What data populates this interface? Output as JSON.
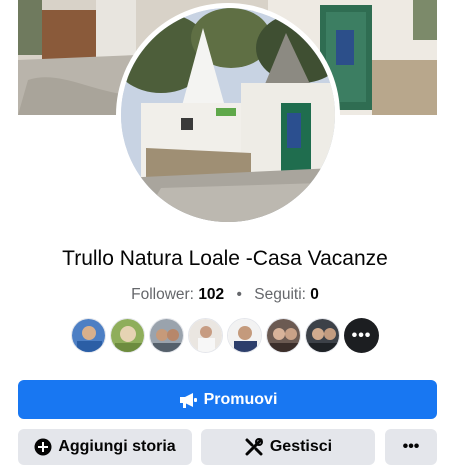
{
  "profile": {
    "name": "Trullo Natura Loale -Casa Vacanze",
    "followers_label": "Follower:",
    "followers_count": "102",
    "separator": "•",
    "following_label": "Seguiti:",
    "following_count": "0"
  },
  "friends": {
    "avatars": [
      "friend-avatar-1",
      "friend-avatar-2",
      "friend-avatar-3",
      "friend-avatar-4",
      "friend-avatar-5",
      "friend-avatar-6",
      "friend-avatar-7"
    ],
    "more_label": "•••"
  },
  "actions": {
    "promote_label": "Promuovi",
    "add_story_label": "Aggiungi storia",
    "manage_label": "Gestisci",
    "more_label": "•••"
  },
  "icons": {
    "promote": "megaphone-icon",
    "add_story": "plus-circle-icon",
    "manage": "wrench-icon",
    "more": "ellipsis-icon"
  },
  "colors": {
    "primary": "#1877f2",
    "secondary_bg": "#e4e6eb",
    "muted_text": "#65676b"
  }
}
